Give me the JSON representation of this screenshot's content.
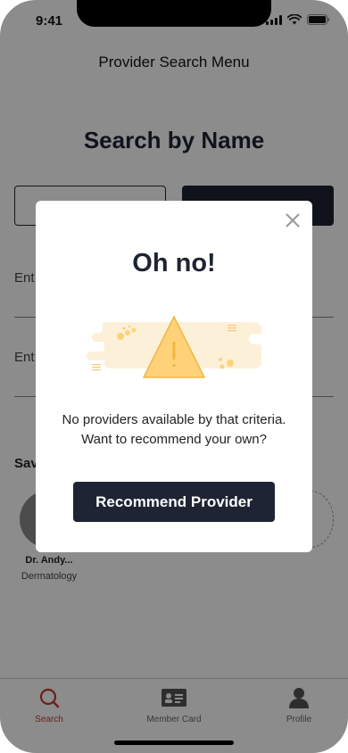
{
  "status_bar": {
    "time": "9:41"
  },
  "header": {
    "title": "Provider Search Menu"
  },
  "main": {
    "title": "Search by Name",
    "fields": [
      {
        "label": "Ent"
      },
      {
        "label": "Ent"
      }
    ],
    "saved": {
      "heading": "Sav",
      "providers": [
        {
          "name": "Dr. Andy...",
          "specialty": "Dermatology"
        }
      ]
    }
  },
  "tab_bar": {
    "items": [
      {
        "label": "Search",
        "icon": "search-icon",
        "active": true
      },
      {
        "label": "Member Card",
        "icon": "member-card-icon",
        "active": false
      },
      {
        "label": "Profile",
        "icon": "profile-icon",
        "active": false
      }
    ]
  },
  "modal": {
    "title": "Oh no!",
    "message_line1": "No providers available by that criteria.",
    "message_line2": "Want to recommend your own?",
    "button_label": "Recommend Provider",
    "illustration_icon": "warning-icon"
  },
  "colors": {
    "primary_dark": "#1e2433",
    "accent_red": "#c0392b",
    "warning_yellow": "#ffd27a",
    "overlay": "rgba(0,0,0,0.45)"
  }
}
